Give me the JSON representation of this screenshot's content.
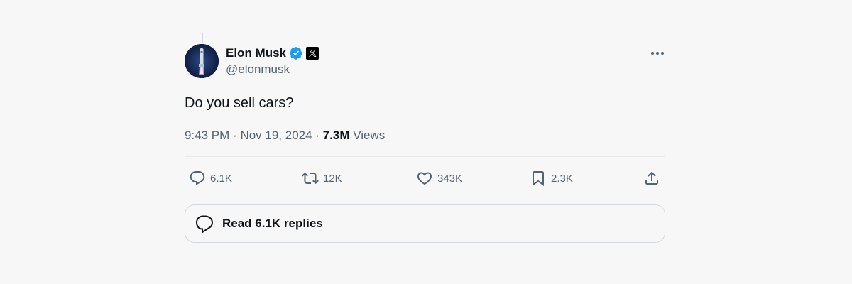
{
  "author": {
    "display_name": "Elon Musk",
    "handle": "@elonmusk",
    "verified_color": "#1d9bf0",
    "affiliate_badge_icon": "x-logo-icon"
  },
  "tweet": {
    "text": "Do you sell cars?",
    "time": "9:43 PM",
    "date": "Nov 19, 2024",
    "views_count": "7.3M",
    "views_label": "Views"
  },
  "actions": {
    "reply_count": "6.1K",
    "retweet_count": "12K",
    "like_count": "343K",
    "bookmark_count": "2.3K"
  },
  "replies": {
    "label": "Read 6.1K replies"
  }
}
